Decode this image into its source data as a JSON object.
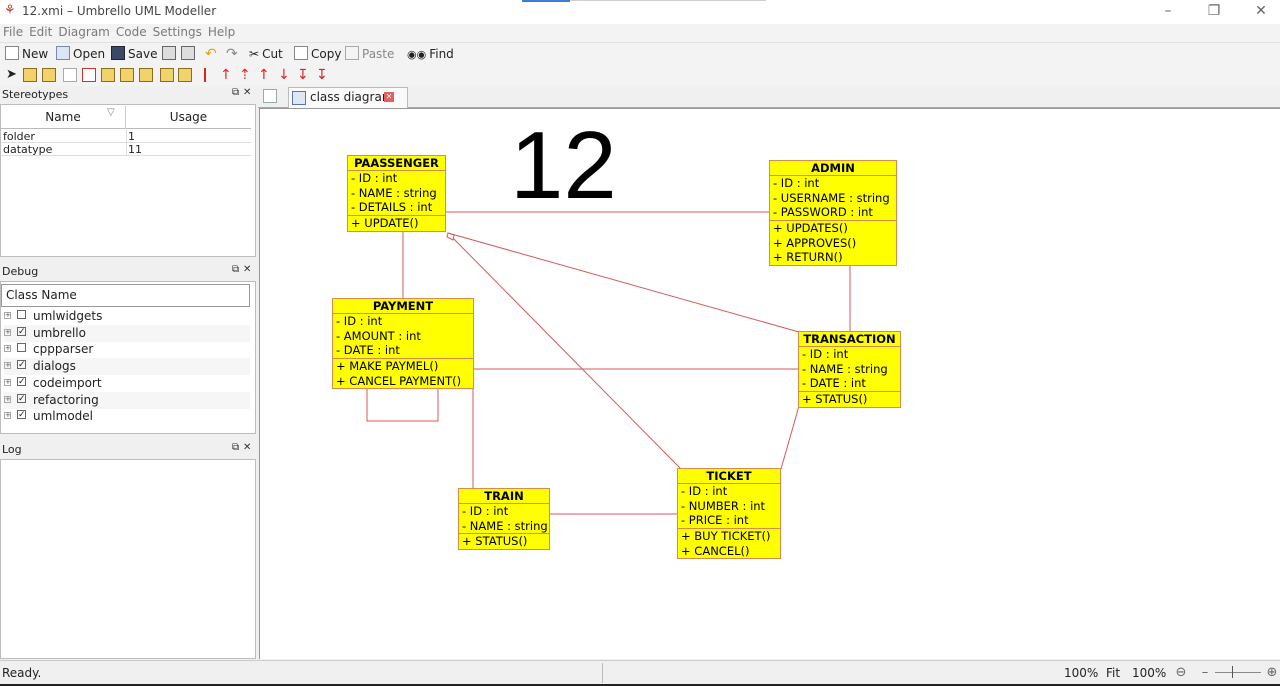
{
  "window": {
    "title": "12.xmi – Umbrello UML Modeller"
  },
  "menu": [
    "File",
    "Edit",
    "Diagram",
    "Code",
    "Settings",
    "Help"
  ],
  "toolbar": {
    "new": "New",
    "open": "Open",
    "save": "Save",
    "cut": "Cut",
    "copy": "Copy",
    "paste": "Paste",
    "find": "Find"
  },
  "stereotypes": {
    "title": "Stereotypes",
    "col_name": "Name",
    "col_usage": "Usage",
    "rows": [
      {
        "name": "folder",
        "usage": "1"
      },
      {
        "name": "datatype",
        "usage": "11"
      }
    ]
  },
  "debug": {
    "title": "Debug",
    "header": "Class Name",
    "items": [
      {
        "label": "umlwidgets",
        "checked": false
      },
      {
        "label": "umbrello",
        "checked": true
      },
      {
        "label": "cppparser",
        "checked": false
      },
      {
        "label": "dialogs",
        "checked": true
      },
      {
        "label": "codeimport",
        "checked": true
      },
      {
        "label": "refactoring",
        "checked": true
      },
      {
        "label": "umlmodel",
        "checked": true
      }
    ]
  },
  "log": {
    "title": "Log"
  },
  "tab": {
    "label": "class diagram"
  },
  "diagram": {
    "number_label": "12",
    "classes": {
      "passenger": {
        "name": "PAASSENGER",
        "attrs": [
          "- ID : int",
          "- NAME : string",
          "- DETAILS : int"
        ],
        "ops": [
          "+ UPDATE()"
        ]
      },
      "admin": {
        "name": "ADMIN",
        "attrs": [
          "- ID : int",
          "- USERNAME : string",
          "- PASSWORD : int"
        ],
        "ops": [
          "+ UPDATES()",
          "+ APPROVES()",
          "+ RETURN()"
        ]
      },
      "payment": {
        "name": "PAYMENT",
        "attrs": [
          "- ID : int",
          "- AMOUNT : int",
          "- DATE : int"
        ],
        "ops": [
          "+ MAKE PAYMEL()",
          "+ CANCEL PAYMENT()"
        ]
      },
      "transaction": {
        "name": "TRANSACTION",
        "attrs": [
          "- ID : int",
          "- NAME : string",
          "- DATE : int"
        ],
        "ops": [
          "+ STATUS()"
        ]
      },
      "train": {
        "name": "TRAIN",
        "attrs": [
          "- ID : int",
          "- NAME : string"
        ],
        "ops": [
          "+ STATUS()"
        ]
      },
      "ticket": {
        "name": "TICKET",
        "attrs": [
          "- ID : int",
          "- NUMBER : int",
          "- PRICE : int"
        ],
        "ops": [
          "+ BUY TICKET()",
          "+ CANCEL()"
        ]
      }
    }
  },
  "status": {
    "message": "Ready.",
    "zoom": "100%",
    "fit": "Fit",
    "zoom2": "100%"
  }
}
